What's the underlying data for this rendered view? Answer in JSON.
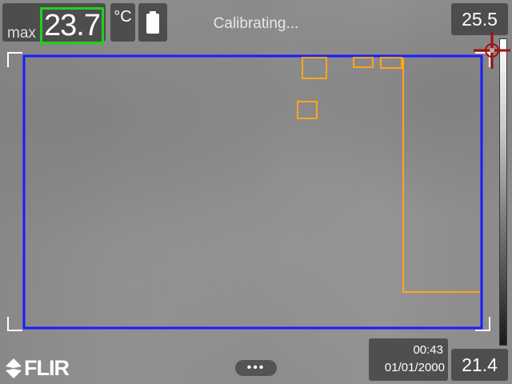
{
  "measurement": {
    "max_label": "max",
    "max_value": "23.7",
    "unit": "°C"
  },
  "status": {
    "text": "Calibrating..."
  },
  "scale": {
    "top_value": "25.5",
    "bottom_value": "21.4"
  },
  "footer": {
    "time": "00:43",
    "date": "01/01/2000",
    "brand": "FLIR",
    "more_label": "•••"
  },
  "icons": {
    "battery": "battery-icon",
    "crosshair": "crosshair-icon",
    "logo": "flir-logo-icon"
  },
  "colors": {
    "measurement_area": "#1a1aff",
    "hot_spots": "#ffa51a",
    "max_highlight": "#1fd11f"
  }
}
